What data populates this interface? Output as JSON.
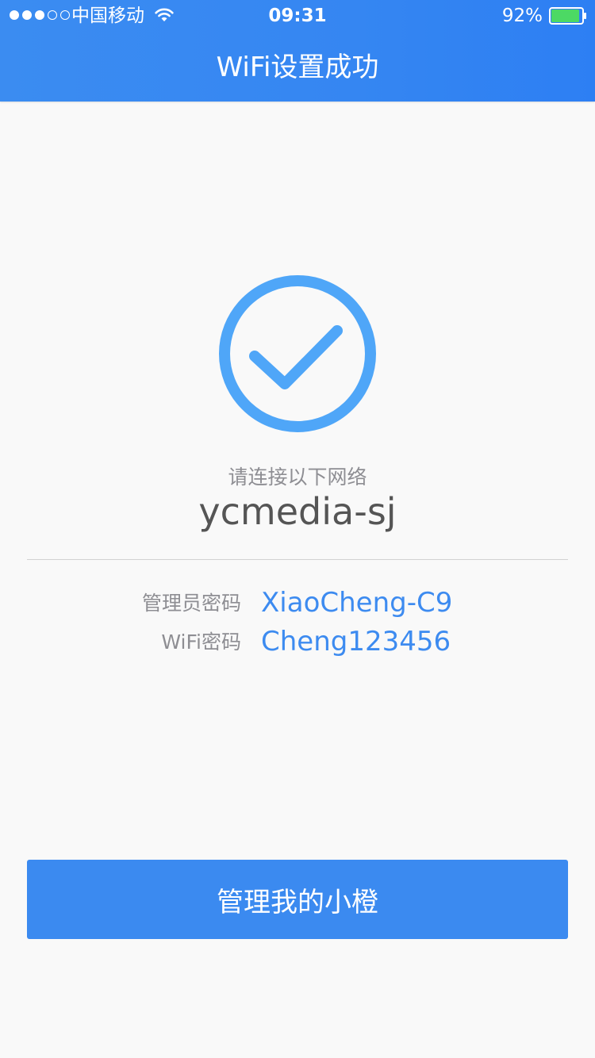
{
  "status_bar": {
    "carrier": "中国移动",
    "time": "09:31",
    "battery": "92%",
    "battery_level": 0.92
  },
  "header": {
    "title": "WiFi设置成功"
  },
  "main": {
    "prompt": "请连接以下网络",
    "ssid": "ycmedia-sj",
    "admin_password_label": "管理员密码",
    "admin_password_value": "XiaoCheng-C9",
    "wifi_password_label": "WiFi密码",
    "wifi_password_value": "Cheng123456"
  },
  "button": {
    "label": "管理我的小橙"
  },
  "icons": {
    "status": "check-circle-icon",
    "wifi": "wifi-icon",
    "battery": "battery-icon"
  },
  "colors": {
    "primary": "#3b8af0",
    "header": "#3586f2",
    "check": "#4fa6f8",
    "value_text": "#3d8bf0",
    "label_text": "#8e8e93",
    "battery_fill": "#4cd964"
  }
}
